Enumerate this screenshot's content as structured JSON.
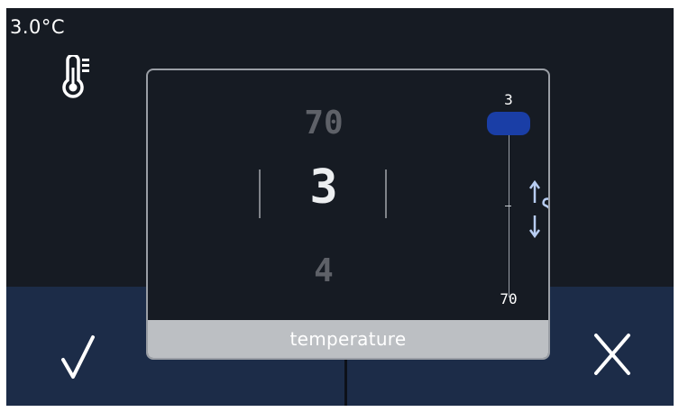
{
  "status": {
    "temperature_readout": "3.0°C",
    "thermometer_icon": "thermometer-icon"
  },
  "dialog": {
    "title": "temperature",
    "wheel": {
      "previous": "70",
      "current": "3",
      "next": "4"
    },
    "slider": {
      "min_label": "3",
      "max_label": "70",
      "value": 3,
      "min": 3,
      "max": 70
    },
    "gesture_icon": "hand-swipe-up-down-icon"
  },
  "actions": {
    "confirm_icon": "checkmark-icon",
    "cancel_icon": "close-icon"
  },
  "colors": {
    "background": "#161b23",
    "bottom_bar": "#1c2c48",
    "slider_thumb": "#1a3ea6",
    "dialog_footer": "#bcbfc3",
    "gesture_icon": "#b8cdf2"
  }
}
